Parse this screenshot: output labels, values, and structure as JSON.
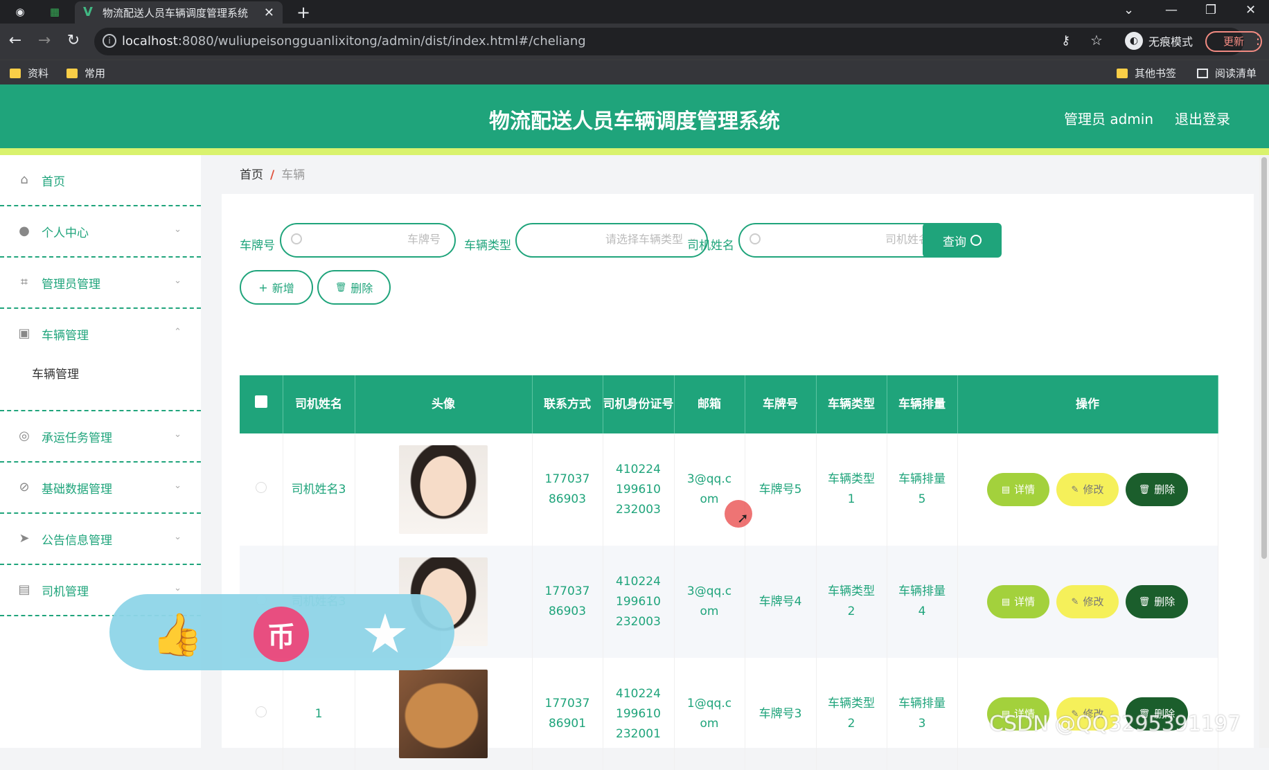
{
  "browser": {
    "tab_title": "物流配送人员车辆调度管理系统",
    "url_host": "localhost",
    "url_rest": ":8080/wuliupeisongguanlixitong/admin/dist/index.html#/cheliang",
    "incognito_label": "无痕模式",
    "update_label": "更新",
    "bookmarks": [
      "资料",
      "常用"
    ],
    "other_bookmarks": "其他书签",
    "reading_list": "阅读清单"
  },
  "header": {
    "title": "物流配送人员车辆调度管理系统",
    "user": "管理员 admin",
    "logout": "退出登录"
  },
  "sidebar": {
    "items": [
      {
        "label": "首页",
        "icon": "home-icon"
      },
      {
        "label": "个人中心",
        "icon": "user-icon"
      },
      {
        "label": "管理员管理",
        "icon": "crop-icon"
      },
      {
        "label": "车辆管理",
        "icon": "clipboard-icon"
      },
      {
        "label": "承运任务管理",
        "icon": "circle-icon"
      },
      {
        "label": "基础数据管理",
        "icon": "compass-icon"
      },
      {
        "label": "公告信息管理",
        "icon": "send-icon"
      },
      {
        "label": "司机管理",
        "icon": "list-icon"
      }
    ],
    "submenu": "车辆管理"
  },
  "breadcrumb": {
    "home": "首页",
    "separator": "/",
    "current": "车辆"
  },
  "search": {
    "plate_label": "车牌号",
    "plate_placeholder": "车牌号",
    "type_label": "车辆类型",
    "type_placeholder": "请选择车辆类型",
    "driver_label": "司机姓名",
    "driver_placeholder": "司机姓名",
    "query_button": "查询"
  },
  "actions": {
    "add": "新增",
    "delete": "删除"
  },
  "table": {
    "headers": [
      "司机姓名",
      "头像",
      "联系方式",
      "司机身份证号",
      "邮箱",
      "车牌号",
      "车辆类型",
      "车辆排量",
      "操作"
    ],
    "row_buttons": {
      "detail": "详情",
      "edit": "修改",
      "delete": "删除"
    },
    "rows": [
      {
        "driver": "司机姓名3",
        "avatar": "portrait-woman",
        "phone": "17703786903",
        "id_card": "410224199610232003",
        "email": "3@qq.com",
        "plate": "车牌号5",
        "type": "车辆类型1",
        "displacement": "车辆排量5"
      },
      {
        "driver": "司机姓名3",
        "avatar": "portrait-woman",
        "phone": "17703786903",
        "id_card": "410224199610232003",
        "email": "3@qq.com",
        "plate": "车牌号4",
        "type": "车辆类型2",
        "displacement": "车辆排量4"
      },
      {
        "driver": "1",
        "avatar": "cat-photo",
        "phone": "17703786901",
        "id_card": "410224199610232001",
        "email": "1@qq.com",
        "plate": "车牌号3",
        "type": "车辆类型2",
        "displacement": "车辆排量3"
      }
    ]
  },
  "watermark": "CSDN @QQ3295391197",
  "colors": {
    "primary": "#1fa47b",
    "accent": "#d9f26d",
    "detail": "#a3d13c",
    "edit": "#f5f05a",
    "delete": "#1b5e2c"
  }
}
